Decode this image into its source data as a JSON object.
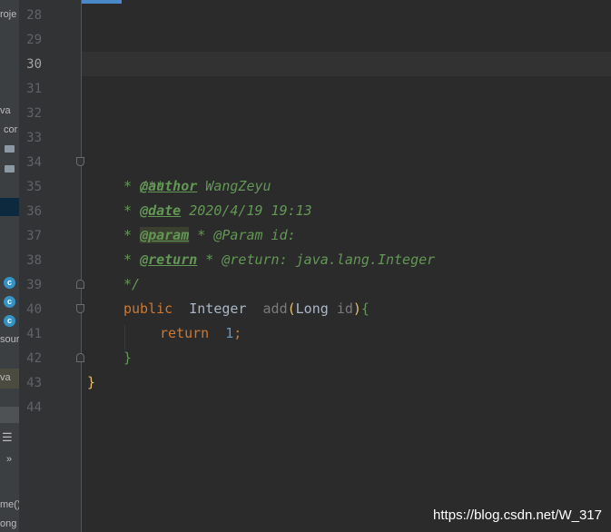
{
  "sidebar": {
    "fragments": [
      "roje",
      "va",
      "cor",
      "sour",
      "va",
      "me()",
      "ong"
    ],
    "chevron": "»"
  },
  "gutter": {
    "line_numbers": [
      "28",
      "29",
      "30",
      "31",
      "32",
      "33",
      "34",
      "35",
      "36",
      "37",
      "38",
      "39",
      "40",
      "41",
      "42",
      "43",
      "44"
    ],
    "current_line": "30"
  },
  "code": {
    "doc_open": "/**",
    "author_star": "* ",
    "author_tag": "@author",
    "author_value": " WangZeyu",
    "date_star": "* ",
    "date_tag": "@date",
    "date_value": " 2020/4/19 19:13",
    "param_star": "* ",
    "param_tag": "@param",
    "param_value": " * @Param id:",
    "return_star": "* ",
    "return_tag": "@return",
    "return_value": " * @return: java.lang.Integer",
    "doc_close": "*/",
    "sig_public": "public",
    "sig_type": "Integer",
    "sig_name": "add",
    "sig_paren_open": "(",
    "sig_param_type": "Long",
    "sig_param_name": "id",
    "sig_paren_close": ")",
    "sig_brace": "{",
    "ret_kw": "return",
    "ret_val": "1",
    "ret_semi": ";",
    "method_close": "}",
    "class_close": "}"
  },
  "watermark": "https://blog.csdn.net/W_317",
  "colors": {
    "background": "#2b2b2b",
    "gutter": "#313335",
    "doc_comment": "#629755",
    "keyword": "#cc7832",
    "number": "#6897bb",
    "text": "#a9b7c6"
  }
}
